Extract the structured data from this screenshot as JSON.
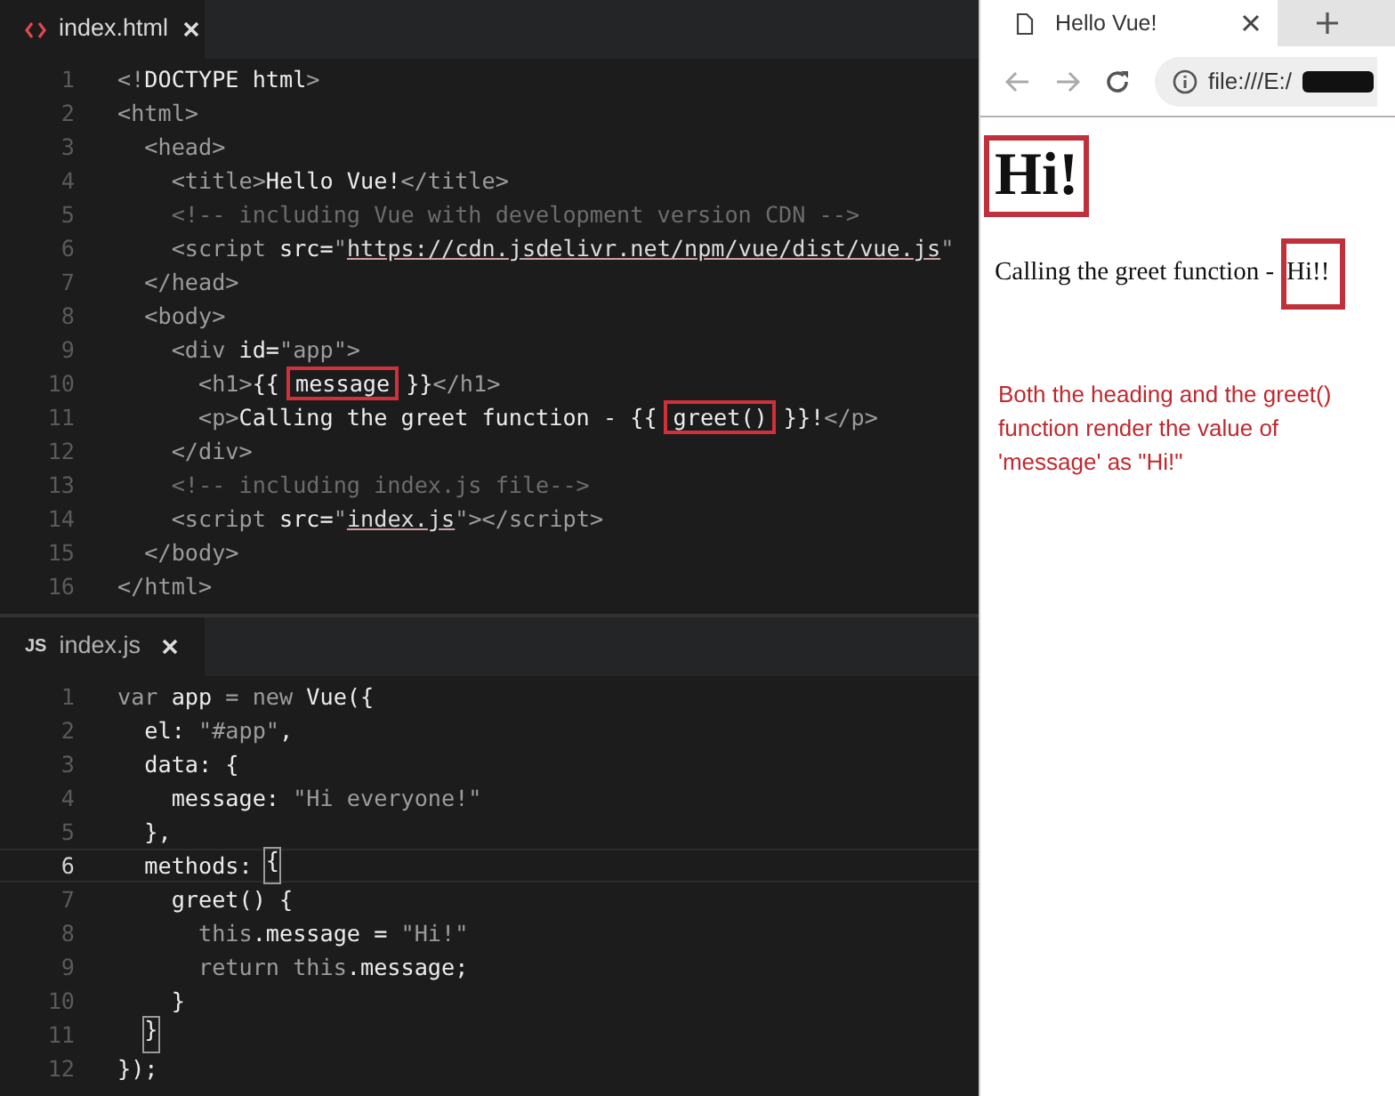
{
  "editors": [
    {
      "tab": {
        "label": "index.html",
        "kind": "html",
        "selected": true
      },
      "lines": [
        {
          "number": "1",
          "current": false,
          "segments": [
            {
              "kind": "punct",
              "text": "<!"
            },
            {
              "kind": "text",
              "text": "DOCTYPE html"
            },
            {
              "kind": "punct",
              "text": ">"
            }
          ]
        },
        {
          "number": "2",
          "current": false,
          "segments": [
            {
              "kind": "punct",
              "text": "<html>"
            }
          ]
        },
        {
          "number": "3",
          "current": false,
          "segments": [
            {
              "kind": "punct",
              "text": "  <head>"
            }
          ]
        },
        {
          "number": "4",
          "current": false,
          "segments": [
            {
              "kind": "punct",
              "text": "    <title>"
            },
            {
              "kind": "text",
              "text": "Hello Vue!"
            },
            {
              "kind": "punct",
              "text": "</title>"
            }
          ]
        },
        {
          "number": "5",
          "current": false,
          "segments": [
            {
              "kind": "comment",
              "text": "    <!-- including Vue with development version CDN -->"
            }
          ]
        },
        {
          "number": "6",
          "current": false,
          "segments": [
            {
              "kind": "punct",
              "text": "    <script "
            },
            {
              "kind": "text",
              "text": "src="
            },
            {
              "kind": "punct",
              "text": "\""
            },
            {
              "kind": "link",
              "text": "https://cdn.jsdelivr.net/npm/vue/dist/vue.js"
            },
            {
              "kind": "punct",
              "text": "\""
            }
          ]
        },
        {
          "number": "7",
          "current": false,
          "segments": [
            {
              "kind": "punct",
              "text": "  </head>"
            }
          ]
        },
        {
          "number": "8",
          "current": false,
          "segments": [
            {
              "kind": "punct",
              "text": "  <body>"
            }
          ]
        },
        {
          "number": "9",
          "current": false,
          "segments": [
            {
              "kind": "punct",
              "text": "    <div "
            },
            {
              "kind": "text",
              "text": "id="
            },
            {
              "kind": "punct",
              "text": "\"app\">"
            }
          ]
        },
        {
          "number": "10",
          "current": false,
          "segments": [
            {
              "kind": "punct",
              "text": "      <h1>"
            },
            {
              "kind": "text",
              "text": "{{"
            },
            {
              "kind": "boxed",
              "text": "message"
            },
            {
              "kind": "text",
              "text": "}}"
            },
            {
              "kind": "punct",
              "text": "</h1>"
            }
          ]
        },
        {
          "number": "11",
          "current": false,
          "segments": [
            {
              "kind": "punct",
              "text": "      <p>"
            },
            {
              "kind": "text",
              "text": "Calling the greet function - {{"
            },
            {
              "kind": "boxed",
              "text": "greet()"
            },
            {
              "kind": "text",
              "text": "}}!"
            },
            {
              "kind": "punct",
              "text": "</p>"
            }
          ]
        },
        {
          "number": "12",
          "current": false,
          "segments": [
            {
              "kind": "punct",
              "text": "    </div>"
            }
          ]
        },
        {
          "number": "13",
          "current": false,
          "segments": [
            {
              "kind": "comment",
              "text": "    <!-- including index.js file-->"
            }
          ]
        },
        {
          "number": "14",
          "current": false,
          "segments": [
            {
              "kind": "punct",
              "text": "    <script "
            },
            {
              "kind": "text",
              "text": "src="
            },
            {
              "kind": "punct",
              "text": "\""
            },
            {
              "kind": "link",
              "text": "index.js"
            },
            {
              "kind": "punct",
              "text": "\"></script>"
            }
          ]
        },
        {
          "number": "15",
          "current": false,
          "segments": [
            {
              "kind": "punct",
              "text": "  </body>"
            }
          ]
        },
        {
          "number": "16",
          "current": false,
          "segments": [
            {
              "kind": "punct",
              "text": "</html>"
            }
          ]
        }
      ]
    },
    {
      "tab": {
        "label": "index.js",
        "kind": "js",
        "badge": "JS",
        "selected": false
      },
      "lines": [
        {
          "number": "1",
          "current": false,
          "segments": [
            {
              "kind": "punct",
              "text": "var "
            },
            {
              "kind": "text",
              "text": "app"
            },
            {
              "kind": "punct",
              "text": " = new "
            },
            {
              "kind": "text",
              "text": "Vue({"
            }
          ]
        },
        {
          "number": "2",
          "current": false,
          "segments": [
            {
              "kind": "text",
              "text": "  el: "
            },
            {
              "kind": "punct",
              "text": "\"#app\""
            },
            {
              "kind": "text",
              "text": ","
            }
          ]
        },
        {
          "number": "3",
          "current": false,
          "segments": [
            {
              "kind": "text",
              "text": "  data: {"
            }
          ]
        },
        {
          "number": "4",
          "current": false,
          "segments": [
            {
              "kind": "text",
              "text": "    message: "
            },
            {
              "kind": "punct",
              "text": "\"Hi everyone!\""
            }
          ]
        },
        {
          "number": "5",
          "current": false,
          "segments": [
            {
              "kind": "text",
              "text": "  },"
            }
          ]
        },
        {
          "number": "6",
          "current": true,
          "segments": [
            {
              "kind": "text",
              "text": "  methods: "
            },
            {
              "kind": "match",
              "text": "{"
            }
          ]
        },
        {
          "number": "7",
          "current": false,
          "segments": [
            {
              "kind": "text",
              "text": "    greet() {"
            }
          ]
        },
        {
          "number": "8",
          "current": false,
          "segments": [
            {
              "kind": "punct",
              "text": "      this"
            },
            {
              "kind": "text",
              "text": ".message = "
            },
            {
              "kind": "punct",
              "text": "\"Hi!\""
            }
          ]
        },
        {
          "number": "9",
          "current": false,
          "segments": [
            {
              "kind": "punct",
              "text": "      return this"
            },
            {
              "kind": "text",
              "text": ".message;"
            }
          ]
        },
        {
          "number": "10",
          "current": false,
          "segments": [
            {
              "kind": "text",
              "text": "    }"
            }
          ]
        },
        {
          "number": "11",
          "current": false,
          "segments": [
            {
              "kind": "match",
              "text": "  }"
            }
          ]
        },
        {
          "number": "12",
          "current": false,
          "segments": [
            {
              "kind": "text",
              "text": "});"
            }
          ]
        }
      ]
    }
  ],
  "browser": {
    "tab_title": "Hello Vue!",
    "address": "file:///E:/",
    "heading": "Hi!",
    "paragraph": "Calling the greet function -",
    "paragraph_value": "Hi!!",
    "note": "Both the heading and the greet() function render the value of 'message' as \"Hi!\""
  }
}
